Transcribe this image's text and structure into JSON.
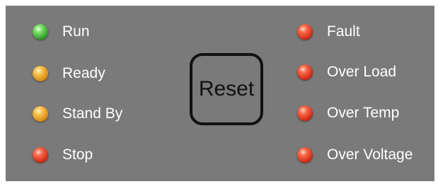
{
  "left_indicators": [
    {
      "label": "Run",
      "color": "green"
    },
    {
      "label": "Ready",
      "color": "amber"
    },
    {
      "label": "Stand By",
      "color": "amber"
    },
    {
      "label": "Stop",
      "color": "red"
    }
  ],
  "right_indicators": [
    {
      "label": "Fault",
      "color": "red"
    },
    {
      "label": "Over Load",
      "color": "red"
    },
    {
      "label": "Over Temp",
      "color": "red"
    },
    {
      "label": "Over Voltage",
      "color": "red"
    }
  ],
  "reset_button": {
    "label": "Reset"
  },
  "colors": {
    "panel": "#7a7a7a",
    "text": "#ffffff",
    "button_border": "#111111"
  }
}
